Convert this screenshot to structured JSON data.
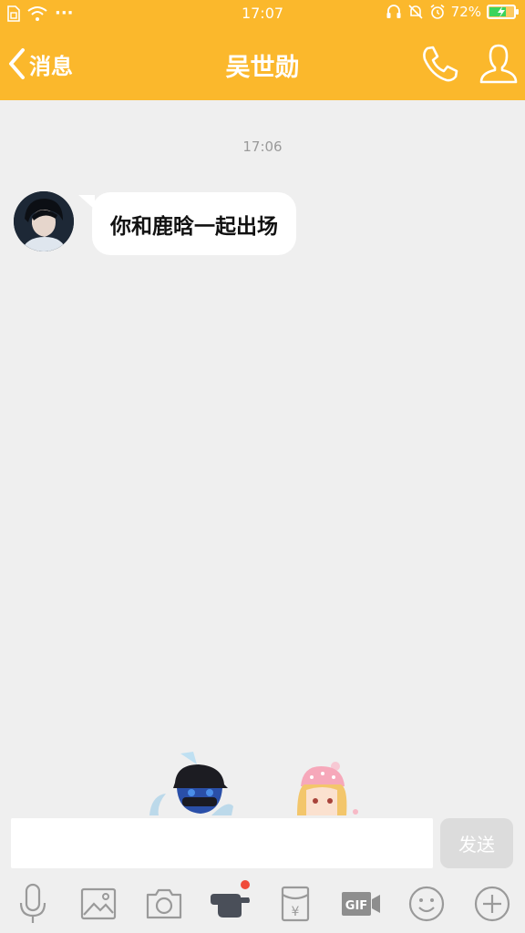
{
  "status_bar": {
    "time": "17:07",
    "battery_percent": "72%",
    "battery_level": 0.72,
    "dots": "···"
  },
  "header": {
    "back_label": "消息",
    "contact_name": "吴世勋"
  },
  "conversation": {
    "timestamp": "17:06",
    "messages": [
      {
        "sender": "contact",
        "text": "你和鹿晗一起出场"
      }
    ]
  },
  "composer": {
    "input_value": "",
    "send_label": "发送"
  },
  "toolbar": {
    "items": [
      "microphone-icon",
      "image-icon",
      "camera-icon",
      "poke-hand-icon",
      "red-packet-icon",
      "gif-icon",
      "emoji-icon",
      "plus-icon"
    ],
    "gif_label": "GIF",
    "currency_symbol": "¥"
  },
  "colors": {
    "accent": "#fbb82c",
    "background": "#efefef",
    "bubble": "#ffffff",
    "send_disabled": "#dcdcdc",
    "notification_dot": "#f04b3a",
    "battery_fill": "#3bd45b"
  }
}
